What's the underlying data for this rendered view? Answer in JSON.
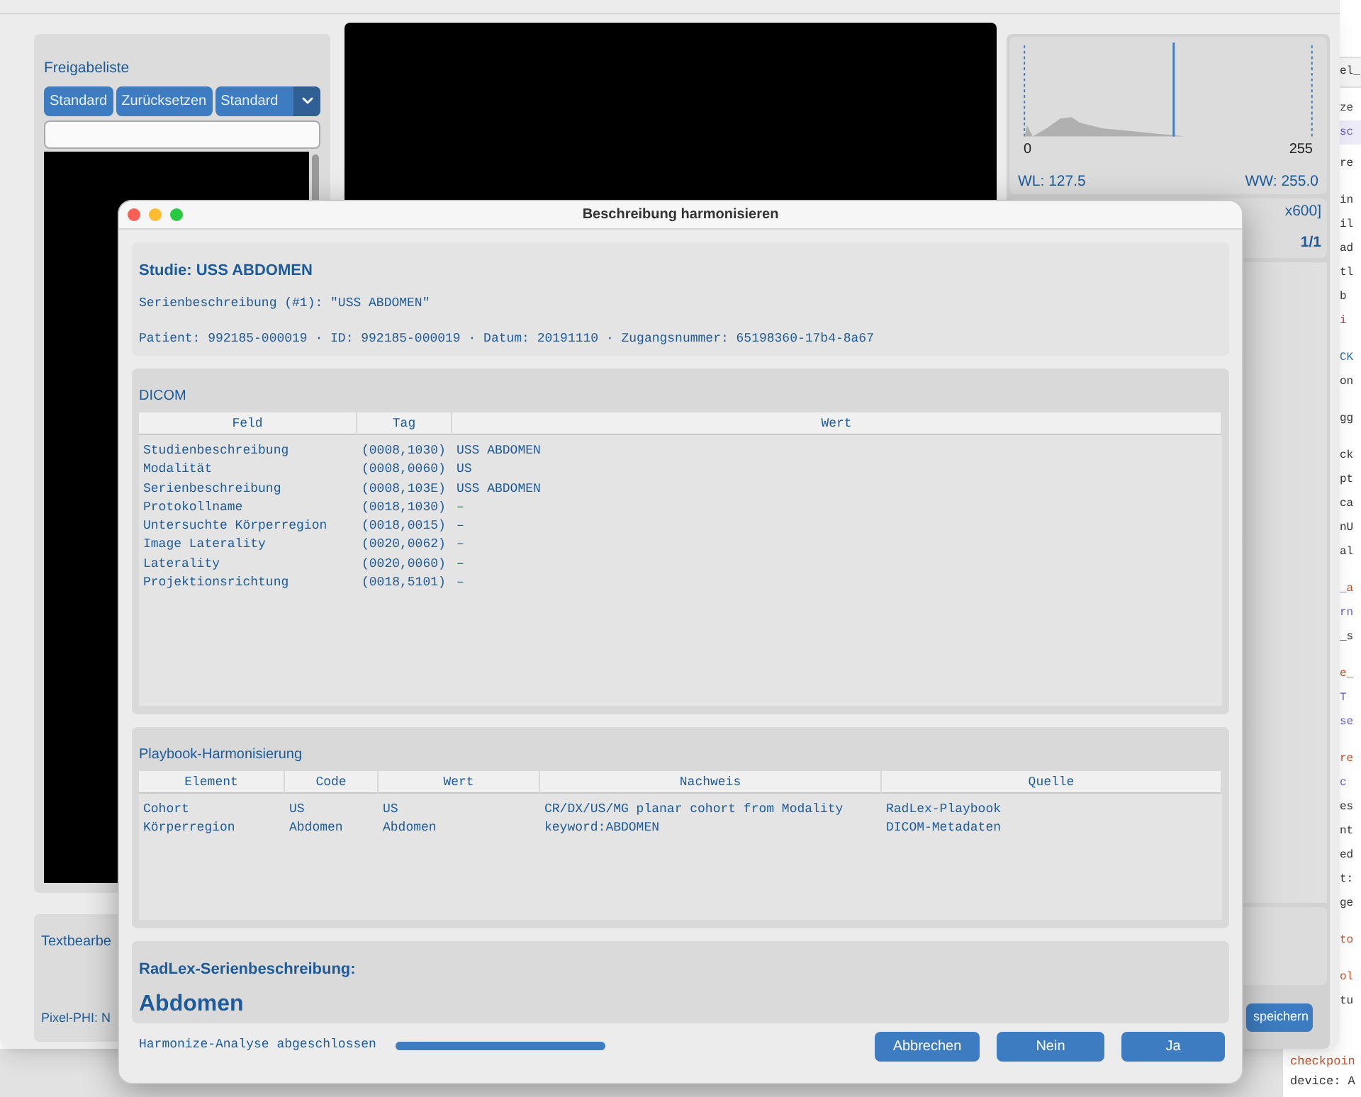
{
  "background_window": {
    "release_list": {
      "title": "Freigabeliste",
      "buttons": [
        "Standard",
        "Zurücksetzen"
      ],
      "preset_dropdown": {
        "value": "Standard"
      }
    },
    "histogram": {
      "min_label": "0",
      "max_label": "255",
      "wl": "WL: 127.5",
      "ww": "WW: 255.0"
    },
    "image_info": {
      "dimensions": "x600]",
      "frame": "1/1"
    },
    "text_edit_panel": {
      "title": "Textbearbe",
      "pixel_phi": "Pixel-PHI: N"
    },
    "save_button": "speichern"
  },
  "code_editor": {
    "tab": "el_",
    "header_lines": [
      {
        "text": "ze",
        "color": "#444444"
      },
      {
        "text": "sc",
        "color": "#6a5acd"
      }
    ],
    "blocks": [
      [
        {
          "text": "re",
          "color": "#333333"
        }
      ],
      [
        {
          "text": "in",
          "color": "#333333"
        },
        {
          "text": "il",
          "color": "#333333"
        },
        {
          "text": "ad",
          "color": "#333333"
        },
        {
          "text": "tl",
          "color": "#333333"
        },
        {
          "text": "b",
          "color": "#333333"
        },
        {
          "text": "i",
          "color": "#c0304a"
        }
      ],
      [
        {
          "text": "CK",
          "color": "#2a6fb0"
        },
        {
          "text": "on",
          "color": "#333333"
        }
      ],
      [
        {
          "text": "gg",
          "color": "#333333"
        }
      ],
      [
        {
          "text": "ck",
          "color": "#333333"
        },
        {
          "text": "pt",
          "color": "#333333"
        },
        {
          "text": "ca",
          "color": "#333333"
        },
        {
          "text": "nU",
          "color": "#333333"
        },
        {
          "text": "al",
          "color": "#333333"
        }
      ],
      [
        {
          "text": "_a",
          "color": "#c0502a"
        },
        {
          "text": "rn",
          "color": "#6a5acd"
        },
        {
          "text": "_s",
          "color": "#333333"
        }
      ],
      [
        {
          "text": "e_",
          "color": "#c0502a"
        },
        {
          "text": "T",
          "color": "#6a5acd"
        },
        {
          "text": "se",
          "color": "#6a5acd"
        }
      ],
      [
        {
          "text": "re",
          "color": "#c0502a"
        },
        {
          "text": "c",
          "color": "#6a5acd"
        },
        {
          "text": "es",
          "color": "#333333"
        },
        {
          "text": "nt",
          "color": "#333333"
        },
        {
          "text": "ed",
          "color": "#333333"
        },
        {
          "text": "t:",
          "color": "#333333"
        },
        {
          "text": "ge",
          "color": "#333333"
        }
      ],
      [
        {
          "text": "to",
          "color": "#c0502a"
        }
      ],
      [
        {
          "text": "ol",
          "color": "#c0502a"
        },
        {
          "text": "tu",
          "color": "#333333"
        }
      ]
    ],
    "bottom_lines": [
      {
        "text": "checkpoin",
        "color": "#c0502a"
      },
      {
        "text": "device: A",
        "color": "#333333"
      }
    ]
  },
  "dialog": {
    "title": "Beschreibung harmonisieren",
    "study": {
      "heading": "Studie: USS ABDOMEN",
      "series_line": "Serienbeschreibung (#1): \"USS ABDOMEN\"",
      "patient_line": "Patient: 992185-000019 · ID: 992185-000019 · Datum: 20191110 · Zugangsnummer: 65198360-17b4-8a67"
    },
    "dicom": {
      "title": "DICOM",
      "columns": [
        "Feld",
        "Tag",
        "Wert"
      ],
      "rows": [
        [
          "Studienbeschreibung",
          "(0008,1030)",
          "USS ABDOMEN"
        ],
        [
          "Modalität",
          "(0008,0060)",
          "US"
        ],
        [
          "Serienbeschreibung",
          "(0008,103E)",
          "USS ABDOMEN"
        ],
        [
          "Protokollname",
          "(0018,1030)",
          "–"
        ],
        [
          "Untersuchte Körperregion",
          "(0018,0015)",
          "–"
        ],
        [
          "Image Laterality",
          "(0020,0062)",
          "–"
        ],
        [
          "Laterality",
          "(0020,0060)",
          "–"
        ],
        [
          "Projektionsrichtung",
          "(0018,5101)",
          "–"
        ]
      ]
    },
    "playbook": {
      "title": "Playbook-Harmonisierung",
      "columns": [
        "Element",
        "Code",
        "Wert",
        "Nachweis",
        "Quelle"
      ],
      "rows": [
        [
          "Cohort",
          "US",
          "US",
          "CR/DX/US/MG planar cohort from Modality",
          "RadLex-Playbook"
        ],
        [
          "Körperregion",
          "Abdomen",
          "Abdomen",
          "keyword:ABDOMEN",
          "DICOM-Metadaten"
        ]
      ]
    },
    "radlex": {
      "label": "RadLex-Serienbeschreibung:",
      "value": "Abdomen"
    },
    "status": {
      "text": "Harmonize-Analyse abgeschlossen",
      "level": 1
    },
    "buttons": [
      "Abbrechen",
      "Nein",
      "Ja"
    ]
  }
}
